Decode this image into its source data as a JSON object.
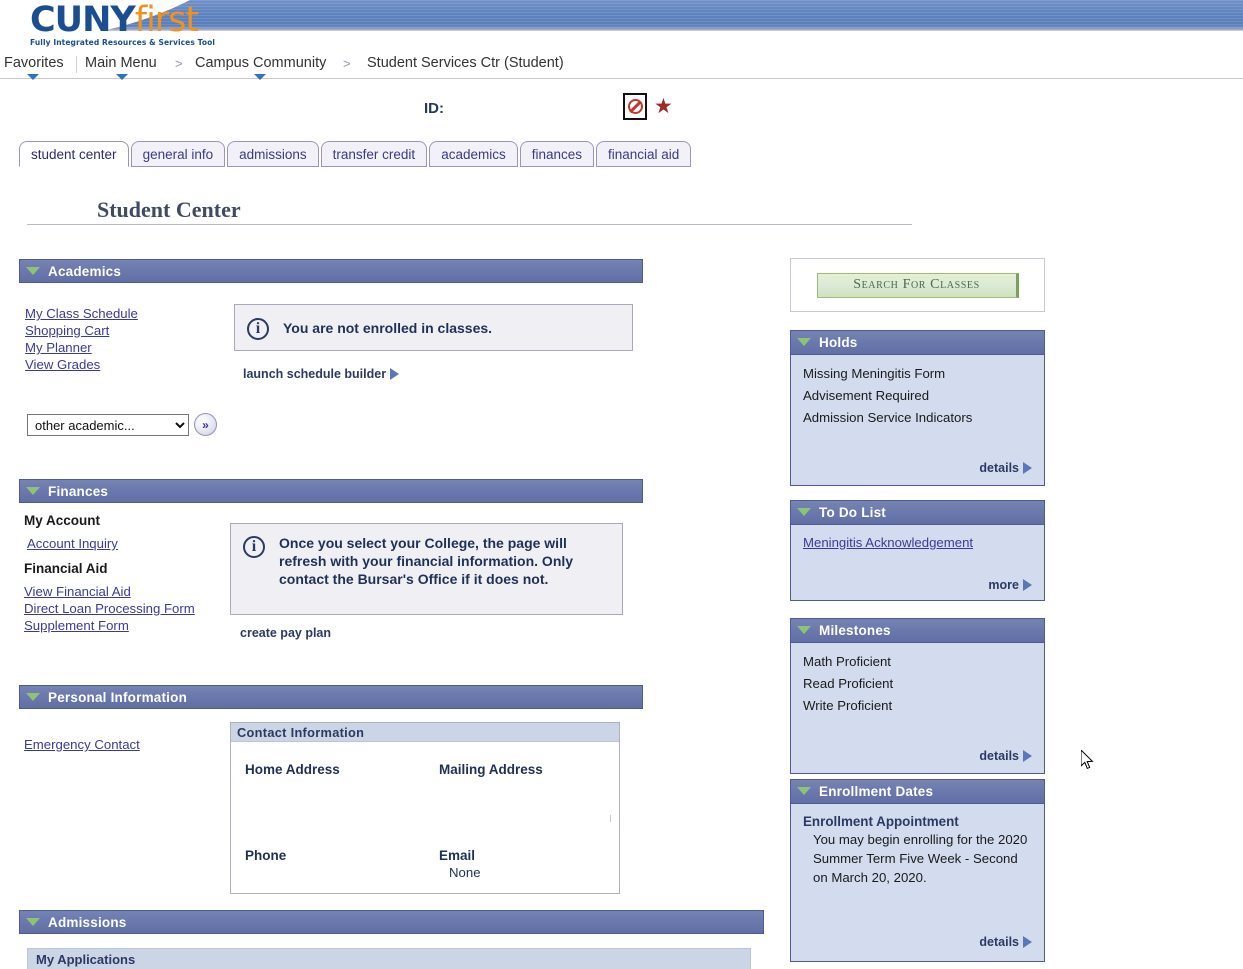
{
  "brand": {
    "logo_primary": "CUNY",
    "logo_secondary": "first",
    "tagline": "Fully Integrated Resources & Services Tool",
    "color_blue": "#1b4e91",
    "color_orange": "#f0921e",
    "band_color": "#5d82bd"
  },
  "breadcrumb": {
    "favorites": "Favorites",
    "main_menu": "Main Menu",
    "sep1": ">",
    "campus_community": "Campus Community",
    "sep2": ">",
    "current": "Student Services Ctr (Student)"
  },
  "id_row": {
    "label": "ID:",
    "value": "",
    "no_entry_icon": "no-entry-icon",
    "star_icon": "star-icon"
  },
  "tabs": [
    {
      "label": "student center",
      "active": true
    },
    {
      "label": "general info",
      "active": false
    },
    {
      "label": "admissions",
      "active": false
    },
    {
      "label": "transfer credit",
      "active": false
    },
    {
      "label": "academics",
      "active": false
    },
    {
      "label": "finances",
      "active": false
    },
    {
      "label": "financial aid",
      "active": false
    }
  ],
  "page_title": "Student Center",
  "academics": {
    "header": "Academics",
    "links": [
      "My Class Schedule",
      "Shopping Cart",
      "My Planner",
      "View Grades"
    ],
    "message": "You are not enrolled in classes.",
    "schedule_builder": "launch schedule builder",
    "select_value": "other academic...",
    "select_options": [
      "other academic..."
    ],
    "go_label": "»"
  },
  "finances": {
    "header": "Finances",
    "my_account_label": "My Account",
    "account_inquiry": "Account Inquiry",
    "financial_aid_label": "Financial Aid",
    "aid_links": [
      "View Financial Aid",
      "Direct Loan Processing Form",
      "Supplement Form"
    ],
    "message": "Once you select your College, the page will refresh with your financial information. Only contact the Bursar's Office if it does not.",
    "create_pay_plan": "create pay plan"
  },
  "personal_information": {
    "header": "Personal Information",
    "emergency_contact": "Emergency Contact",
    "contact_panel_title": "Contact Information",
    "home_address_label": "Home Address",
    "home_address_value": "",
    "mailing_address_label": "Mailing Address",
    "mailing_address_value": "",
    "phone_label": "Phone",
    "phone_value": "",
    "email_label": "Email",
    "email_value": "None"
  },
  "admissions": {
    "header": "Admissions",
    "my_applications": "My Applications"
  },
  "right_column": {
    "search_button": "Search For Classes",
    "holds": {
      "header": "Holds",
      "items": [
        "Missing Meningitis Form",
        "Advisement Required",
        "Admission Service Indicators"
      ],
      "footer": "details"
    },
    "todo": {
      "header": "To Do List",
      "items": [
        "Meningitis Acknowledgement"
      ],
      "footer": "more"
    },
    "milestones": {
      "header": "Milestones",
      "items": [
        "Math Proficient",
        "Read Proficient",
        "Write Proficient"
      ],
      "footer": "details"
    },
    "enrollment_dates": {
      "header": "Enrollment Dates",
      "appointment_title": "Enrollment Appointment",
      "appointment_text": "You may begin enrolling for the 2020 Summer Term Five Week - Second on March 20, 2020.",
      "footer": "details"
    }
  }
}
